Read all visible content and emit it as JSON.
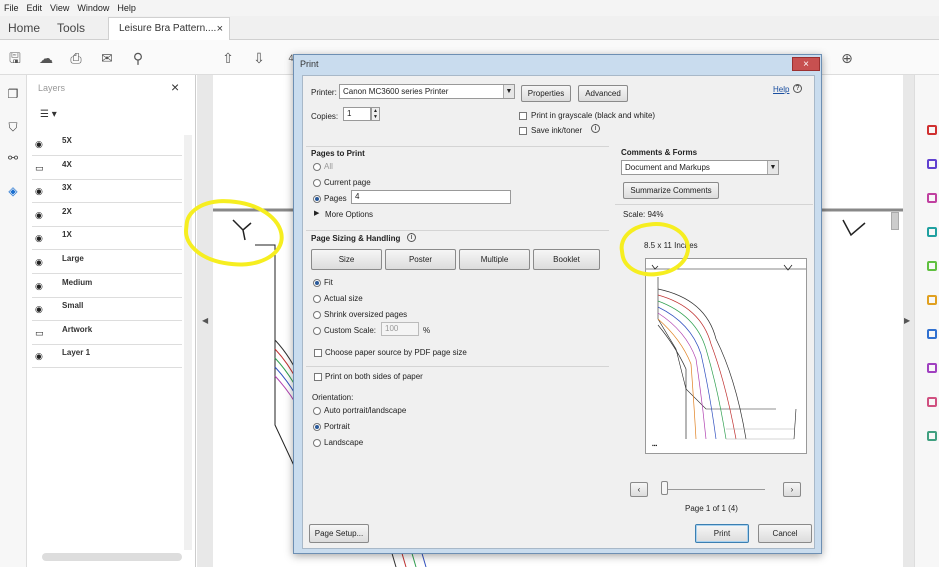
{
  "menu": [
    "File",
    "Edit",
    "View",
    "Window",
    "Help"
  ],
  "tabs": {
    "home": "Home",
    "tools": "Tools",
    "document": "Leisure Bra Pattern....",
    "close": "×"
  },
  "toolbar": {
    "page_number": "4"
  },
  "layers_panel": {
    "title": "Layers",
    "close": "×",
    "options_icon": "☰ ▾",
    "layers": [
      {
        "name": "5X",
        "visible": true
      },
      {
        "name": "4X",
        "visible": false
      },
      {
        "name": "3X",
        "visible": true
      },
      {
        "name": "2X",
        "visible": true
      },
      {
        "name": "1X",
        "visible": true
      },
      {
        "name": "Large",
        "visible": true
      },
      {
        "name": "Medium",
        "visible": true
      },
      {
        "name": "Small",
        "visible": true
      },
      {
        "name": "Artwork",
        "visible": false
      },
      {
        "name": "Layer 1",
        "visible": true
      }
    ]
  },
  "dialog": {
    "title": "Print",
    "close": "×",
    "help": "Help",
    "printer_label": "Printer:",
    "printer_value": "Canon MC3600 series Printer",
    "properties": "Properties",
    "advanced": "Advanced",
    "copies_label": "Copies:",
    "copies_value": "1",
    "grayscale": "Print in grayscale (black and white)",
    "save_ink": "Save ink/toner",
    "pages_to_print": "Pages to Print",
    "all": "All",
    "current_page": "Current page",
    "pages": "Pages",
    "pages_value": "4",
    "more_options": "More Options",
    "page_sizing": "Page Sizing & Handling",
    "size_btn": "Size",
    "poster_btn": "Poster",
    "multiple_btn": "Multiple",
    "booklet_btn": "Booklet",
    "fit": "Fit",
    "actual_size": "Actual size",
    "shrink": "Shrink oversized pages",
    "custom_scale": "Custom Scale:",
    "custom_scale_value": "100",
    "percent": "%",
    "choose_paper": "Choose paper source by PDF page size",
    "both_sides": "Print on both sides of paper",
    "orientation": "Orientation:",
    "auto_orient": "Auto portrait/landscape",
    "portrait": "Portrait",
    "landscape": "Landscape",
    "comments_forms": "Comments & Forms",
    "comments_value": "Document and Markups",
    "summarize": "Summarize Comments",
    "scale": "Scale: 94%",
    "paper_size": "8.5 x 11 Inches",
    "page_of": "Page 1 of 1 (4)",
    "page_setup": "Page Setup...",
    "print": "Print",
    "cancel": "Cancel"
  },
  "colors": {
    "annotation_yellow": "#f6ee20",
    "dialog_frame": "#c9dcee",
    "close_red": "#c75050",
    "pattern_lines": [
      "#c03030",
      "#30a050",
      "#3050c0",
      "#b040b0",
      "#e08020",
      "#303030"
    ]
  }
}
